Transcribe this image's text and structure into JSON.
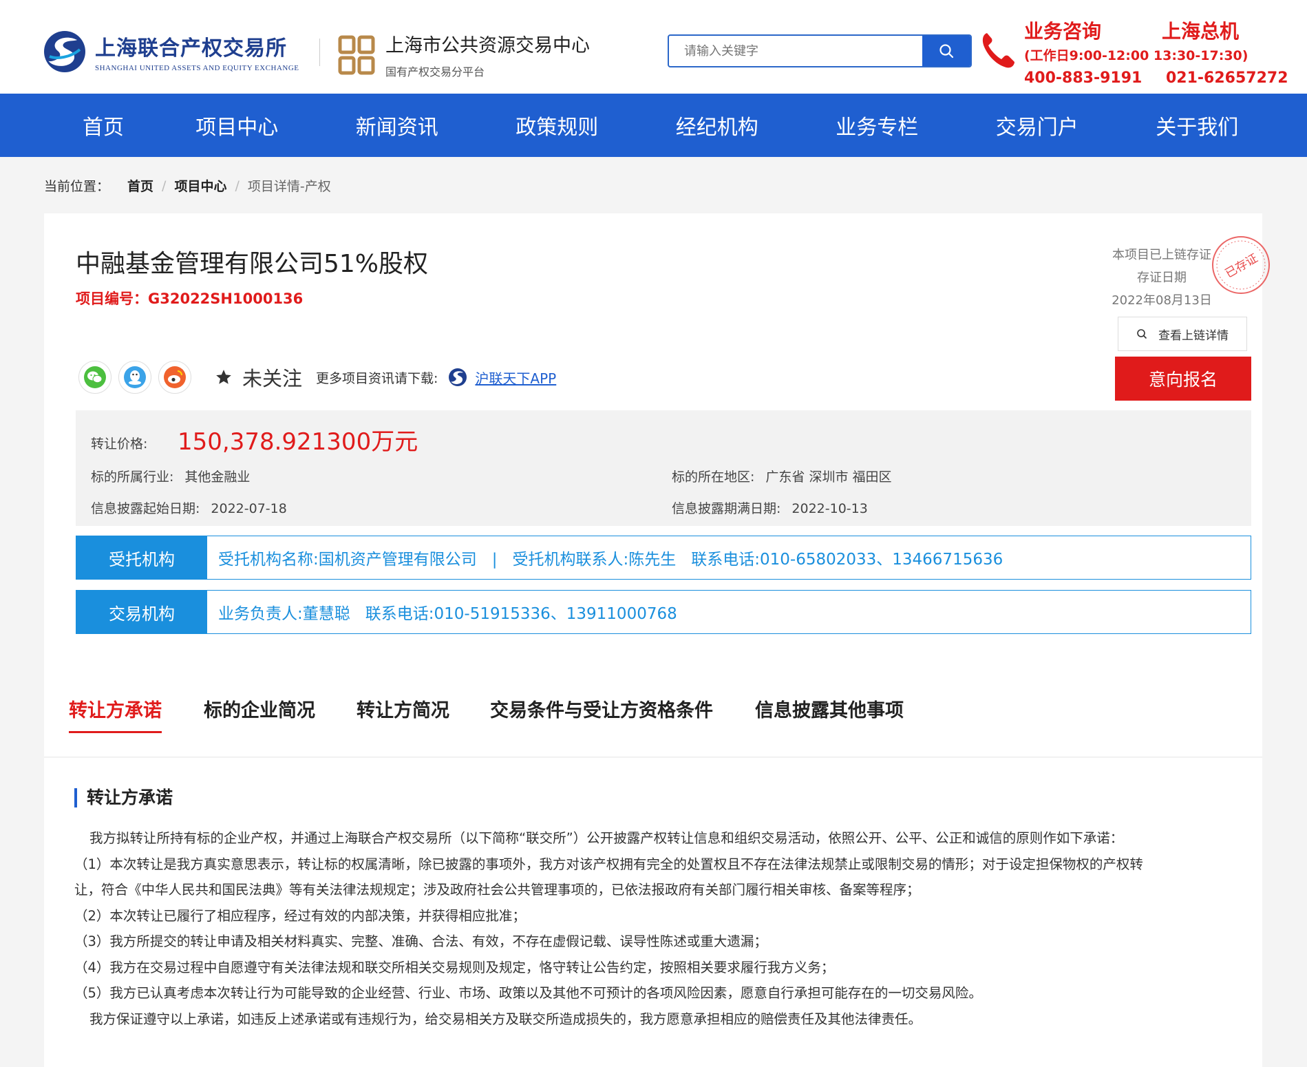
{
  "header": {
    "logo1_cn": "上海联合产权交易所",
    "logo1_en": "SHANGHAI UNITED ASSETS AND EQUITY EXCHANGE",
    "logo2_cn": "上海市公共资源交易中心",
    "logo2_sub": "国有产权交易分平台",
    "search_placeholder": "请输入关键字",
    "contact": {
      "label1": "业务咨询",
      "label2": "上海总机",
      "hours": "(工作日9:00-12:00 13:30-17:30)",
      "phone1": "400-883-9191",
      "phone2": "021-62657272"
    }
  },
  "nav": [
    "首页",
    "项目中心",
    "新闻资讯",
    "政策规则",
    "经纪机构",
    "业务专栏",
    "交易门户",
    "关于我们"
  ],
  "breadcrumb": {
    "label": "当前位置：",
    "home": "首页",
    "center": "项目中心",
    "current": "项目详情-产权"
  },
  "project": {
    "title": "中融基金管理有限公司51%股权",
    "code": "项目编号：G32022SH1000136",
    "chain_text": "本项目已上链存证",
    "chain_date_label": "存证日期",
    "chain_date": "2022年08月13日",
    "seal_text": "已存证",
    "chain_btn": "查看上链详情",
    "apply_btn": "意向报名",
    "follow": "未关注",
    "more": "更多项目资讯请下载:",
    "app": "沪联天下APP",
    "price_label": "转让价格:",
    "price": "150,378.921300万元",
    "industry_label": "标的所属行业:",
    "industry": "其他金融业",
    "region_label": "标的所在地区:",
    "region": "广东省 深圳市 福田区",
    "start_label": "信息披露起始日期:",
    "start": "2022-07-18",
    "end_label": "信息披露期满日期:",
    "end": "2022-10-13"
  },
  "agency": {
    "tag": "受托机构",
    "name": "受托机构名称:国机资产管理有限公司",
    "sep": "|",
    "contact": "受托机构联系人:陈先生",
    "phone": "联系电话:010-65802033、13466715636"
  },
  "exchange": {
    "tag": "交易机构",
    "person": "业务负责人:董慧聪",
    "phone": "联系电话:010-51915336、13911000768"
  },
  "tabs": [
    "转让方承诺",
    "标的企业简况",
    "转让方简况",
    "交易条件与受让方资格条件",
    "信息披露其他事项"
  ],
  "commitment": {
    "title": "转让方承诺",
    "lines": [
      "我方拟转让所持有标的企业产权，并通过上海联合产权交易所（以下简称“联交所”）公开披露产权转让信息和组织交易活动，依照公开、公平、公正和诚信的原则作如下承诺：",
      "（1）本次转让是我方真实意思表示，转让标的权属清晰，除已披露的事项外，我方对该产权拥有完全的处置权且不存在法律法规禁止或限制交易的情形；对于设定担保物权的产权转",
      "让，符合《中华人民共和国民法典》等有关法律法规规定；涉及政府社会公共管理事项的，已依法报政府有关部门履行相关审核、备案等程序；",
      "（2）本次转让已履行了相应程序，经过有效的内部决策，并获得相应批准；",
      "（3）我方所提交的转让申请及相关材料真实、完整、准确、合法、有效，不存在虚假记载、误导性陈述或重大遗漏；",
      "（4）我方在交易过程中自愿遵守有关法律法规和联交所相关交易规则及规定，恪守转让公告约定，按照相关要求履行我方义务；",
      "（5）我方已认真考虑本次转让行为可能导致的企业经营、行业、市场、政策以及其他不可预计的各项风险因素，愿意自行承担可能存在的一切交易风险。",
      "我方保证遵守以上承诺，如违反上述承诺或有违规行为，给交易相关方及联交所造成损失的，我方愿意承担相应的赔偿责任及其他法律责任。"
    ]
  },
  "colors": {
    "nav_blue": "#1f5fd0",
    "accent_red": "#e01b1b",
    "org_blue": "#1a8fdd"
  }
}
